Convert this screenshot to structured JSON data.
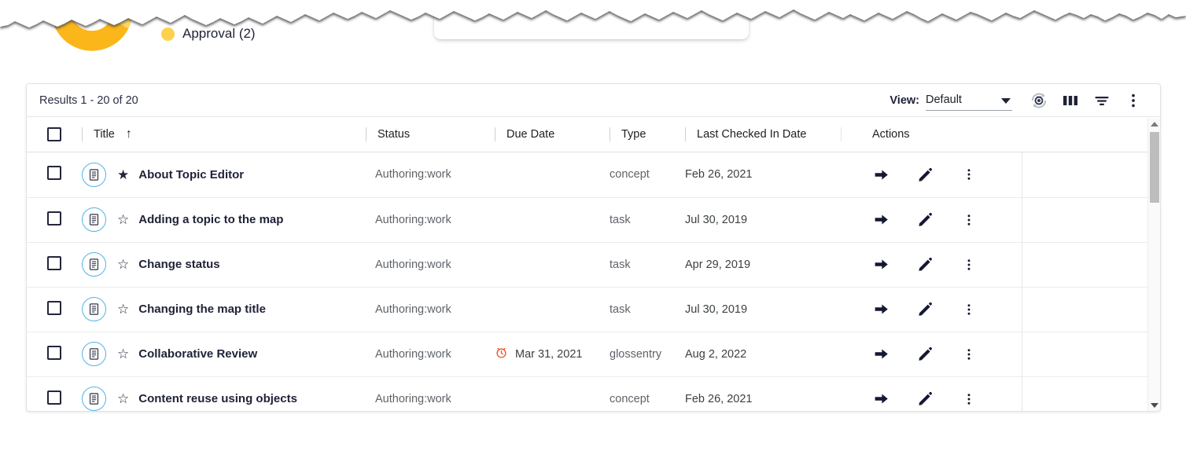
{
  "dashboard": {
    "legend": [
      {
        "label": "Approval (2)",
        "color": "#FDD14E"
      }
    ],
    "ghost_card_text": "",
    "donut_segments": [
      {
        "name": "segment-orange",
        "color": "#F5871F",
        "value": 1
      },
      {
        "name": "segment-amber",
        "color": "#FBB619",
        "value": 4
      },
      {
        "name": "segment-light",
        "color": "#FDD663",
        "value": 1
      }
    ]
  },
  "toolbar": {
    "results_count": "Results 1 - 20 of 20",
    "view_label": "View:",
    "view_value": "Default",
    "icons": [
      {
        "name": "refresh-icon",
        "title": "Refresh"
      },
      {
        "name": "columns-icon",
        "title": "Columns"
      },
      {
        "name": "filter-icon",
        "title": "Filter"
      },
      {
        "name": "more-options-icon",
        "title": "More options"
      }
    ]
  },
  "table": {
    "columns": [
      {
        "key": "select",
        "label": ""
      },
      {
        "key": "title",
        "label": "Title",
        "sort": "↑"
      },
      {
        "key": "status",
        "label": "Status"
      },
      {
        "key": "due",
        "label": "Due Date"
      },
      {
        "key": "type",
        "label": "Type"
      },
      {
        "key": "lcid",
        "label": "Last Checked In Date"
      },
      {
        "key": "actions",
        "label": "Actions"
      }
    ],
    "rows": [
      {
        "title": "About Topic Editor",
        "starred": "★",
        "status": "Authoring:work",
        "due": "",
        "due_overdue": false,
        "type": "concept",
        "lcid": "Feb 26, 2021"
      },
      {
        "title": "Adding a topic to the map",
        "starred": "☆",
        "status": "Authoring:work",
        "due": "",
        "due_overdue": false,
        "type": "task",
        "lcid": "Jul 30, 2019"
      },
      {
        "title": "Change status",
        "starred": "☆",
        "status": "Authoring:work",
        "due": "",
        "due_overdue": false,
        "type": "task",
        "lcid": "Apr 29, 2019"
      },
      {
        "title": "Changing the map title",
        "starred": "☆",
        "status": "Authoring:work",
        "due": "",
        "due_overdue": false,
        "type": "task",
        "lcid": "Jul 30, 2019"
      },
      {
        "title": "Collaborative Review",
        "starred": "☆",
        "status": "Authoring:work",
        "due": "Mar 31, 2021",
        "due_overdue": true,
        "type": "glossentry",
        "lcid": "Aug 2, 2022"
      },
      {
        "title": "Content reuse using objects",
        "starred": "☆",
        "status": "Authoring:work",
        "due": "",
        "due_overdue": false,
        "type": "concept",
        "lcid": "Feb 26, 2021"
      }
    ],
    "row_actions": [
      {
        "name": "go-arrow-icon",
        "title": "Open"
      },
      {
        "name": "edit-pencil-icon",
        "title": "Edit"
      },
      {
        "name": "row-more-icon",
        "title": "More"
      }
    ]
  },
  "colors": {
    "doc_chip_border": "#4fb3e8",
    "overdue": "#F4511E",
    "checkbox": "#23263b",
    "text_primary": "#1f2236",
    "text_secondary": "#5f6368"
  }
}
